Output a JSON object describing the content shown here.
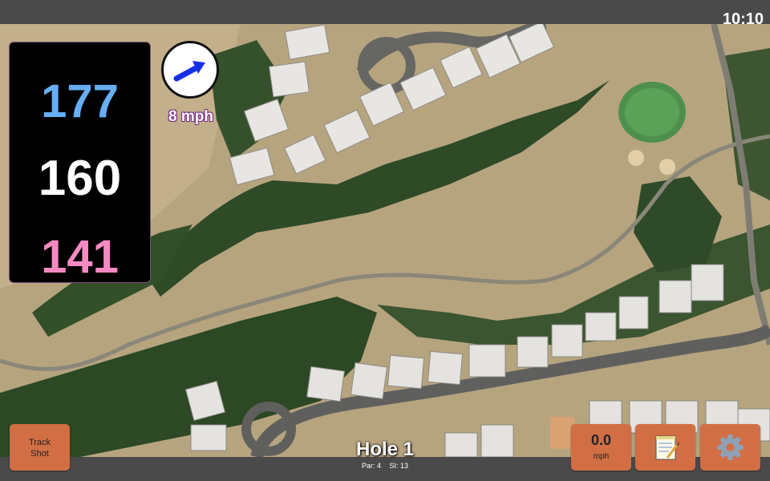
{
  "status_bar": {
    "time": "10:10"
  },
  "distances": {
    "back": "177",
    "middle": "160",
    "front": "141"
  },
  "wind": {
    "speed_label": "8 mph",
    "direction_icon": "arrow-icon",
    "arrow_color": "#1530e6"
  },
  "hole": {
    "title": "Hole 1",
    "par": "Par: 4",
    "si": "SI: 13"
  },
  "buttons": {
    "track_shot_line1": "Track",
    "track_shot_line2": "Shot",
    "speed_value": "0.0",
    "speed_unit": "mph",
    "notes_icon": "notepad-icon",
    "settings_icon": "gear-icon"
  },
  "colors": {
    "back_distance": "#67aef4",
    "middle_distance": "#ffffff",
    "front_distance": "#f58ac3",
    "button_bg": "#d26e44"
  }
}
